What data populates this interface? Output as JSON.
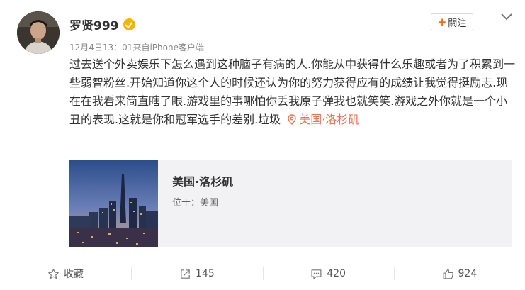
{
  "user": {
    "name": "罗贤999",
    "meta": "12月4日13：01来自iPhone客户端",
    "follow_label": "關注"
  },
  "post": {
    "text": "过去送个外卖娱乐下怎么遇到这种脑子有病的人.你能从中获得什么乐趣或者为了积累到一些弱智粉丝.开始知道你这个人的时候还认为你的努力获得应有的成绩让我觉得挺励志.现在在我看来简直瞎了眼.游戏里的事哪怕你丢我原子弹我也就笑笑.游戏之外你就是一个小丑的表现.这就是你和冠军选手的差别.垃圾",
    "location_tag": "美国·洛杉矶"
  },
  "location_card": {
    "title": "美国·洛杉矶",
    "subtitle": "位于：美国"
  },
  "actions": {
    "favorite": "收藏",
    "repost": "145",
    "comment": "420",
    "like": "924"
  },
  "colors": {
    "accent": "#eb7350",
    "verified": "#f7b500",
    "follow_plus": "#f76700"
  },
  "icons": [
    "verified-icon",
    "plus-icon",
    "chevron-down-icon",
    "location-pin-icon",
    "star-icon",
    "repost-icon",
    "comment-icon",
    "like-icon"
  ]
}
